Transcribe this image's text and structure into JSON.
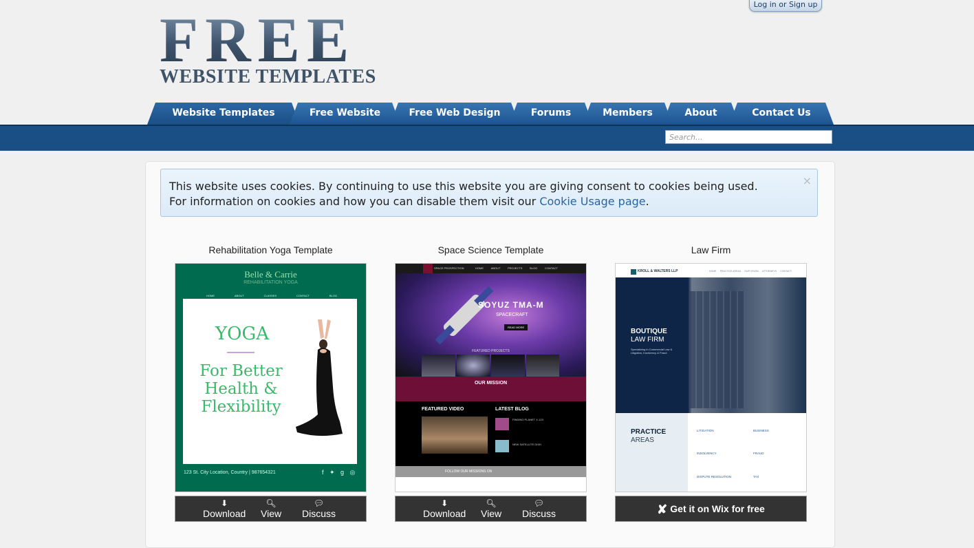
{
  "header": {
    "logo_main": "FREE",
    "logo_sub": "WEBSITE TEMPLATES",
    "login_label": "Log in or Sign up"
  },
  "nav": {
    "tabs": [
      "Website Templates",
      "Free Website",
      "Free Web Design",
      "Forums",
      "Members",
      "About",
      "Contact Us"
    ]
  },
  "search": {
    "placeholder": "Search..."
  },
  "cookie": {
    "line1": "This website uses cookies. By continuing to use this website you are giving consent to cookies being used.",
    "line2_prefix": "For information on cookies and how you can disable them visit our ",
    "link": "Cookie Usage page",
    "line2_suffix": ".",
    "close": "×"
  },
  "cards": [
    {
      "title": "Rehabilitation Yoga Template",
      "thumb": {
        "brand": "Belle & Carrie",
        "tagline": "REHABILITATION YOGA",
        "nav": [
          "HOME",
          "ABOUT",
          "CLASSES",
          "CONTACT",
          "BLOG"
        ],
        "headline": "YOGA",
        "text": "For Better Health & Flexibility",
        "footer": "123 St. City Location, Country | 987654321"
      },
      "actions": [
        "Download",
        "View",
        "Discuss"
      ]
    },
    {
      "title": "Space Science Template",
      "thumb": {
        "brand": "SPACE PROSPECTION",
        "nav": [
          "HOME",
          "ABOUT",
          "PROJECTS",
          "BLOG",
          "CONTACT"
        ],
        "hero": "SOYUZ TMA-M",
        "hero_sub": "SPACECRAFT",
        "button": "READ MORE",
        "featured": "FEATURED PROJECTS",
        "mission": "OUR MISSION",
        "video": "FEATURED VIDEO",
        "blog": "LATEST BLOG",
        "post1": "FINDING PLANET X-123",
        "post2": "NEW SATELLITE DISH",
        "follow": "FOLLOW OUR MISSIONS ON"
      },
      "actions": [
        "Download",
        "View",
        "Discuss"
      ]
    },
    {
      "title": "Law Firm",
      "thumb": {
        "brand": "KROLL & WALTERS LLP",
        "nav": [
          "HOME",
          "PRACTICE AREAS",
          "OUR VISION",
          "ATTORNEYS",
          "CONTACT"
        ],
        "hero1": "BOUTIQUE",
        "hero2": "LAW FIRM",
        "hero_text": "Specializing in Commercial Law & Litigation, Insolvency & Fraud",
        "section1": "PRACTICE",
        "section2": "AREAS",
        "areas": [
          "LITIGATION",
          "BUSINESS",
          "INSOLVENCY",
          "FRAUD",
          "DISPUTE RESOLUTION",
          "TAX"
        ]
      },
      "wix_label": "Get it on Wix for free"
    }
  ]
}
